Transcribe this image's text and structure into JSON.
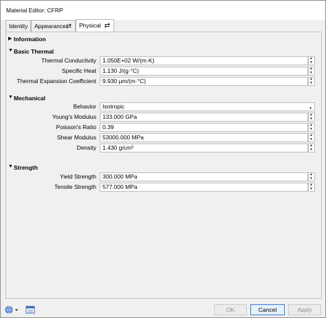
{
  "window": {
    "title": "Material Editor: CFRP"
  },
  "tabs": [
    {
      "label": "Identity"
    },
    {
      "label": "Appearance"
    },
    {
      "label": "Physical"
    }
  ],
  "tab_swap_icon": "⇄",
  "sections": {
    "information": {
      "label": "Information",
      "expanded": false
    },
    "basic_thermal": {
      "label": "Basic Thermal",
      "expanded": true,
      "props": [
        {
          "label": "Thermal Conductivity",
          "value": "1.050E+02 W/(m·K)"
        },
        {
          "label": "Specific Heat",
          "value": "1.130 J/(g·°C)"
        },
        {
          "label": "Thermal Expansion Coefficient",
          "value": "9.930 µm/(m·°C)"
        }
      ]
    },
    "mechanical": {
      "label": "Mechanical",
      "expanded": true,
      "behavior": {
        "label": "Behavior",
        "value": "Isotropic"
      },
      "props": [
        {
          "label": "Young's Modulus",
          "value": "133.000 GPa"
        },
        {
          "label": "Poisson's Ratio",
          "value": "0.39"
        },
        {
          "label": "Shear Modulus",
          "value": "53000.000 MPa"
        },
        {
          "label": "Density",
          "value": "1.430 g/cm³"
        }
      ]
    },
    "strength": {
      "label": "Strength",
      "expanded": true,
      "props": [
        {
          "label": "Yield Strength",
          "value": "300.000 MPa"
        },
        {
          "label": "Tensile Strength",
          "value": "577.000 MPa"
        }
      ]
    }
  },
  "buttons": {
    "ok": "OK",
    "cancel": "Cancel",
    "apply": "Apply"
  },
  "icons": {
    "globe": "globe-icon",
    "list": "list-icon"
  }
}
